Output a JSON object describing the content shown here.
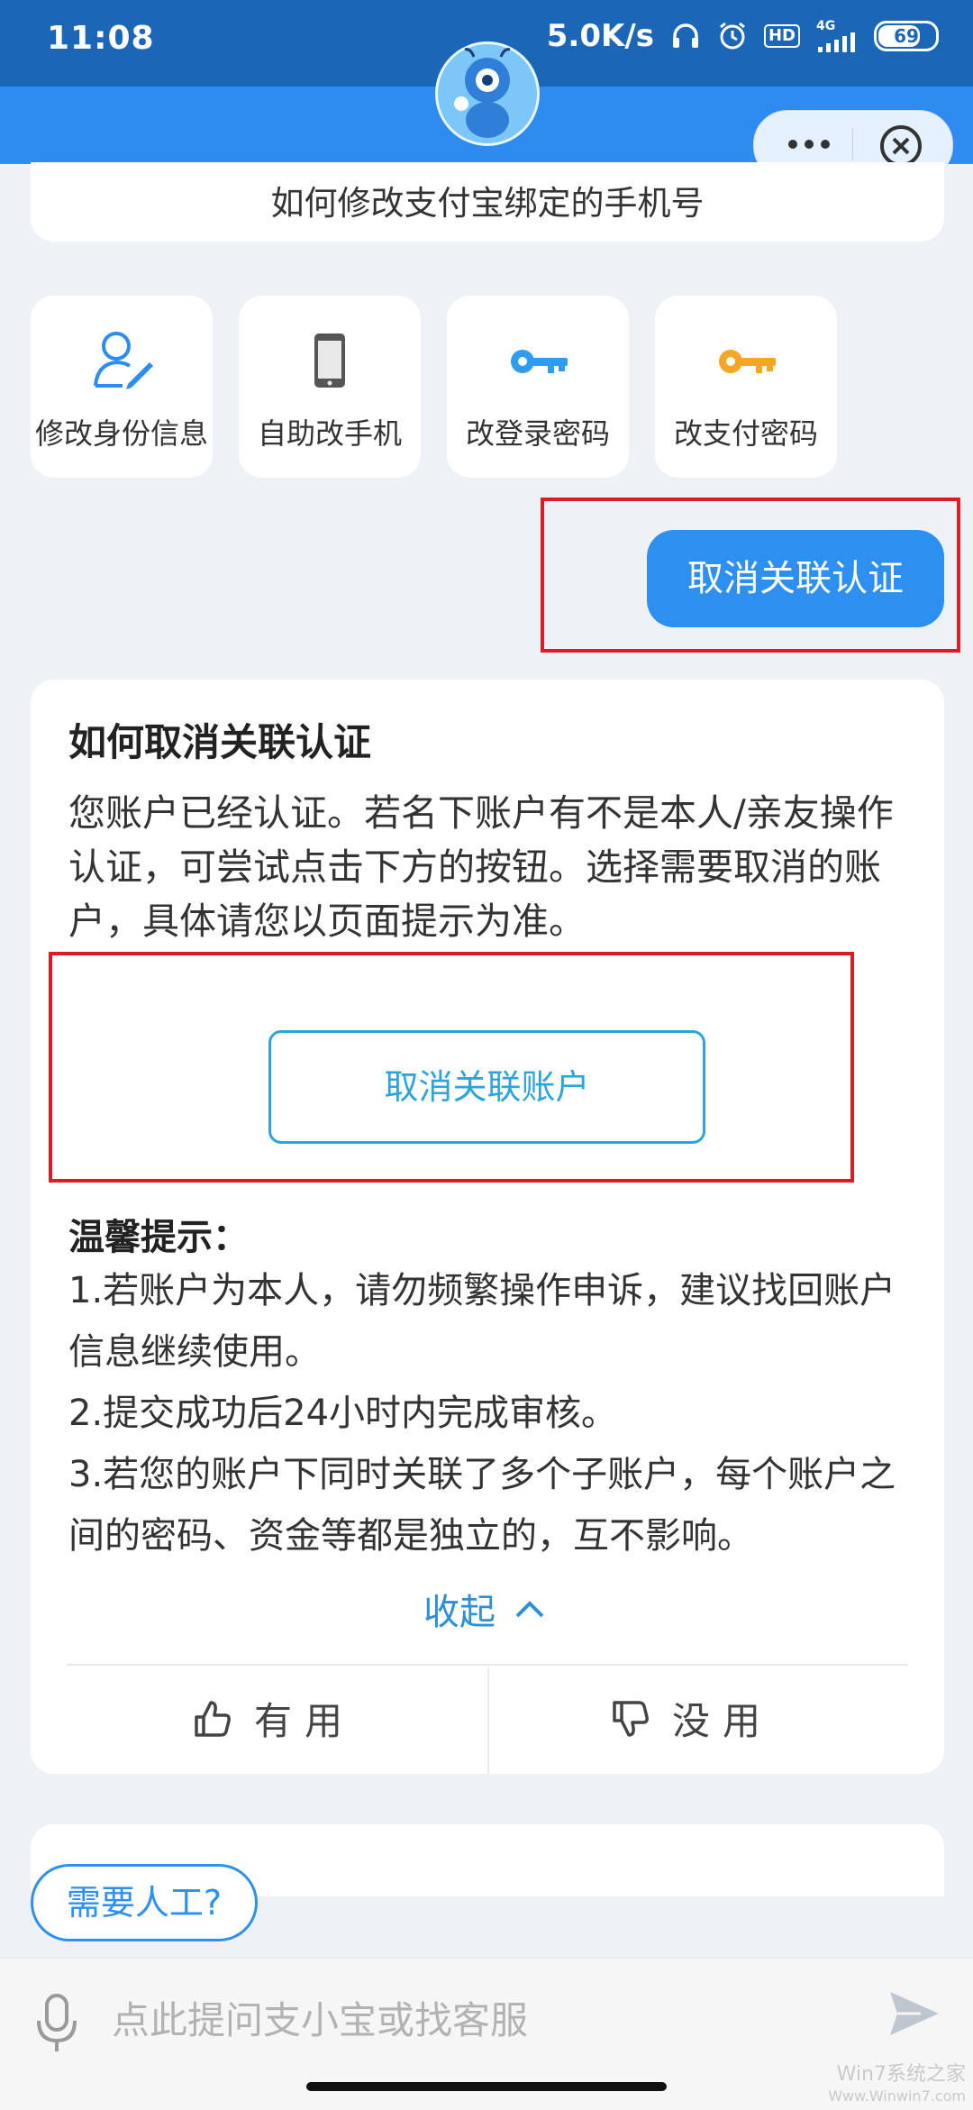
{
  "status_bar": {
    "time": "11:08",
    "speed": "5.0K/s",
    "hd": "HD",
    "network": "4G",
    "battery": "69"
  },
  "colors": {
    "header_blue": "#2e8cf0",
    "status_blue": "#1c66b8",
    "accent_teal": "#2ea4dc",
    "highlight_red": "#e01b24"
  },
  "question_card": {
    "text": "如何修改支付宝绑定的手机号"
  },
  "quick_actions": [
    {
      "label": "修改身份信息",
      "icon": "user-edit-icon"
    },
    {
      "label": "自助改手机",
      "icon": "phone-icon"
    },
    {
      "label": "改登录密码",
      "icon": "blue-key-icon"
    },
    {
      "label": "改支付密码",
      "icon": "orange-key-icon"
    }
  ],
  "user_message": "取消关联认证",
  "answer": {
    "title": "如何取消关联认证",
    "body": "您账户已经认证。若名下账户有不是本人/亲友操作认证，可尝试点击下方的按钮。选择需要取消的账户，具体请您以页面提示为准。",
    "action_button": "取消关联账户",
    "tips_title": "温馨提示：",
    "tips": [
      "1.若账户为本人，请勿频繁操作申诉，建议找回账户信息继续使用。",
      "2.提交成功后24小时内完成审核。",
      "3.若您的账户下同时关联了多个子账户，每个账户之间的密码、资金等都是独立的，互不影响。"
    ],
    "collapse_label": "收起",
    "useful_label": "有用",
    "useless_label": "没用"
  },
  "human_button": "需要人工?",
  "input": {
    "placeholder": "点此提问支小宝或找客服"
  },
  "watermark": {
    "line1": "Win7系统之家",
    "line2": "Www.Winwin7.com"
  }
}
